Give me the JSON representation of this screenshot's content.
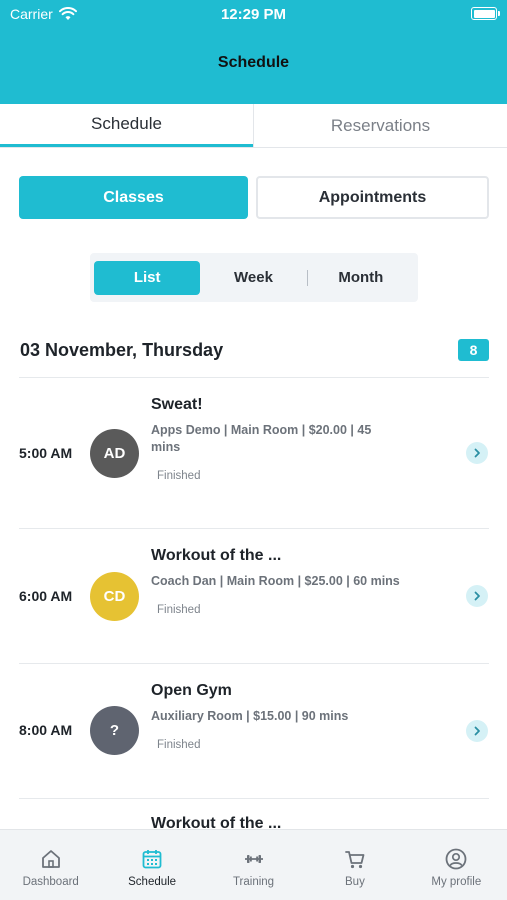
{
  "status_bar": {
    "carrier": "Carrier",
    "time": "12:29 PM"
  },
  "nav": {
    "title": "Schedule"
  },
  "top_tabs": [
    {
      "label": "Schedule",
      "active": true
    },
    {
      "label": "Reservations",
      "active": false
    }
  ],
  "segments": [
    {
      "label": "Classes",
      "active": true
    },
    {
      "label": "Appointments",
      "active": false
    }
  ],
  "view_options": [
    {
      "label": "List",
      "active": true
    },
    {
      "label": "Week",
      "active": false
    },
    {
      "label": "Month",
      "active": false
    }
  ],
  "date_header": {
    "title": "03 November, Thursday",
    "count": "8"
  },
  "classes": [
    {
      "time": "5:00 AM",
      "initials": "AD",
      "avatar_color": "#5a5a5a",
      "name": "Sweat!",
      "meta": "Apps Demo | Main Room | $20.00 | 45 mins",
      "status": "Finished"
    },
    {
      "time": "6:00 AM",
      "initials": "CD",
      "avatar_color": "#e6c233",
      "name": "Workout of the ...",
      "meta": "Coach Dan | Main Room | $25.00 | 60 mins",
      "status": "Finished"
    },
    {
      "time": "8:00 AM",
      "initials": "?",
      "avatar_color": "#5f6470",
      "name": "Open Gym",
      "meta": "Auxiliary Room | $15.00 | 90 mins",
      "status": "Finished"
    },
    {
      "name": "Workout of the ..."
    }
  ],
  "bottom_nav": [
    {
      "label": "Dashboard",
      "icon": "home-icon",
      "active": false
    },
    {
      "label": "Schedule",
      "icon": "calendar-icon",
      "active": true
    },
    {
      "label": "Training",
      "icon": "dumbbell-icon",
      "active": false
    },
    {
      "label": "Buy",
      "icon": "cart-icon",
      "active": false
    },
    {
      "label": "My profile",
      "icon": "profile-icon",
      "active": false
    }
  ],
  "colors": {
    "accent": "#1fbcd1",
    "accent_light": "#d5f1f6"
  }
}
